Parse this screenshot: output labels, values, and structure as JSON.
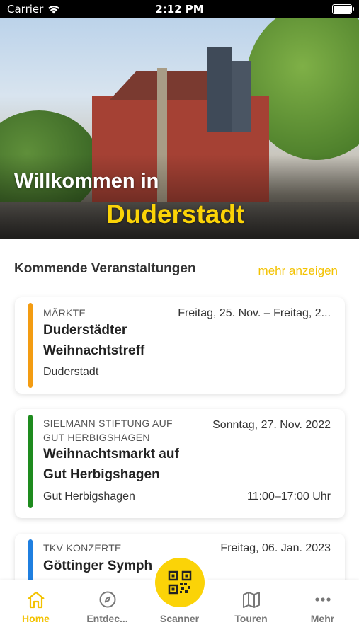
{
  "status_bar": {
    "carrier": "Carrier",
    "time": "2:12 PM"
  },
  "hero": {
    "line1": "Willkommen in",
    "line2": "Duderstadt"
  },
  "events_section": {
    "title": "Kommende Veranstaltungen",
    "more_link": "mehr anzeigen"
  },
  "events": [
    {
      "category": "MÄRKTE",
      "title_line1": "Duderstädter",
      "title_line2": "Weihnachtstreff",
      "location": "Duderstadt",
      "date": "Freitag, 25. Nov. – Freitag, 2...",
      "time": "",
      "accent_color": "#F39C12"
    },
    {
      "category_line1": "SIELMANN STIFTUNG AUF",
      "category_line2": "GUT HERBIGSHAGEN",
      "title_line1": "Weihnachtsmarkt auf",
      "title_line2": "Gut Herbigshagen",
      "location": "Gut Herbigshagen",
      "date": "Sonntag, 27. Nov. 2022",
      "time": "11:00–17:00 Uhr",
      "accent_color": "#1E8B1E"
    },
    {
      "category": "TKV KONZERTE",
      "title_line1": "Göttinger Symph",
      "date": "Freitag, 06. Jan. 2023",
      "accent_color": "#1F7FE0"
    }
  ],
  "tabs": [
    {
      "label": "Home",
      "icon": "home-icon",
      "active": true
    },
    {
      "label": "Entdec...",
      "icon": "compass-icon",
      "active": false
    },
    {
      "label": "Scanner",
      "icon": "qr-code-icon",
      "active": false
    },
    {
      "label": "Touren",
      "icon": "map-icon",
      "active": false
    },
    {
      "label": "Mehr",
      "icon": "more-dots-icon",
      "active": false
    }
  ],
  "colors": {
    "accent": "#FBD307",
    "link": "#F3C200"
  }
}
